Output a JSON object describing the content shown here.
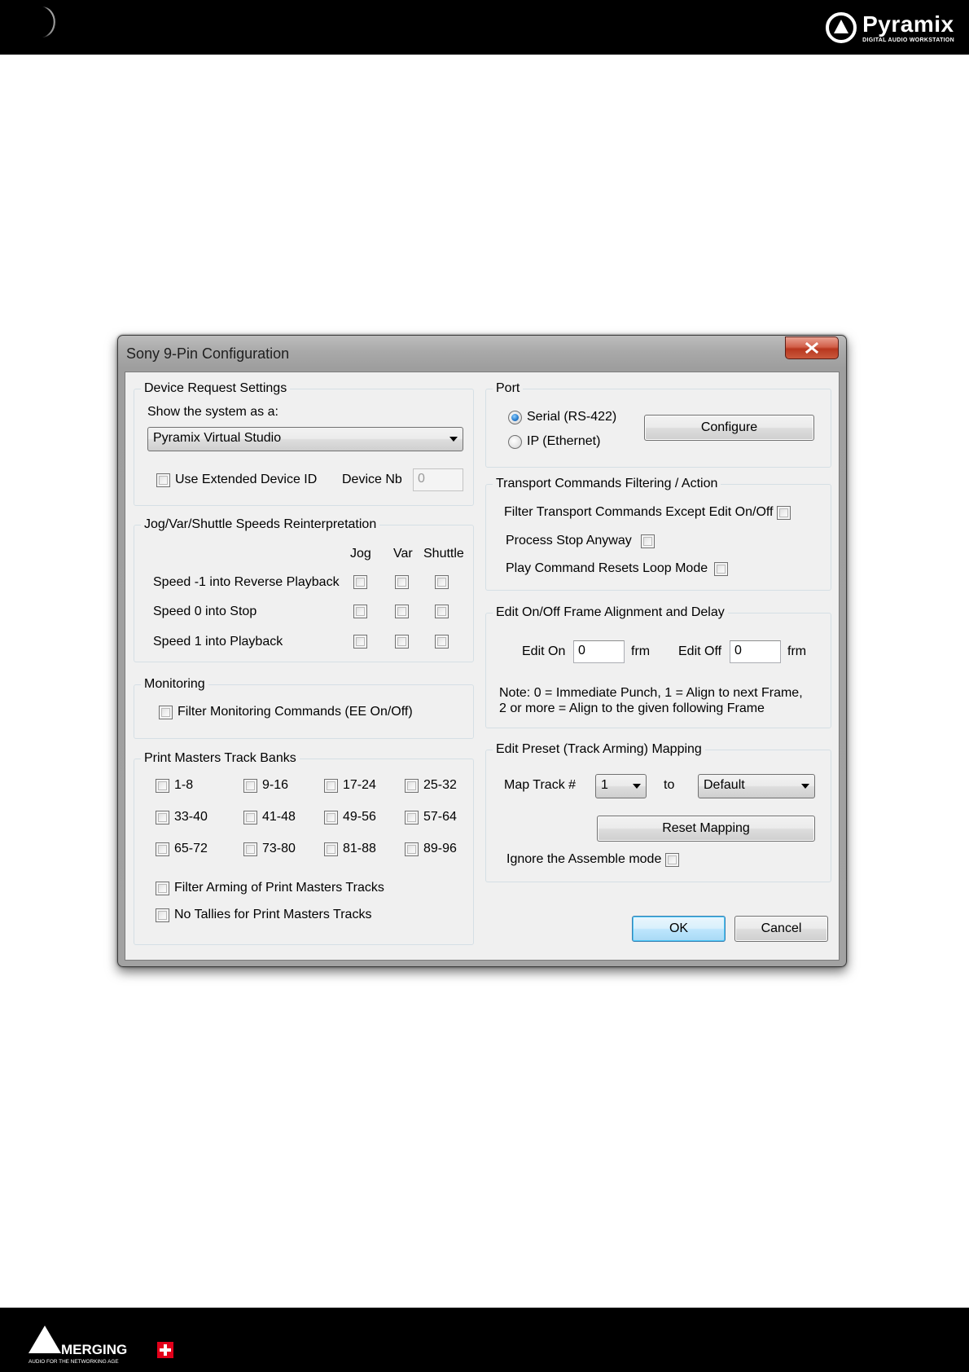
{
  "header": {
    "brand_name": "Pyramix",
    "brand_tagline": "DIGITAL AUDIO WORKSTATION"
  },
  "footer": {
    "brand": "MERGING",
    "tagline": "AUDIO FOR THE NETWORKING AGE"
  },
  "dialog": {
    "title": "Sony 9-Pin Configuration",
    "device_request": {
      "title": "Device Request Settings",
      "show_as_label": "Show the system as a:",
      "show_as_value": "Pyramix Virtual Studio",
      "extended_id_label": "Use Extended Device ID",
      "device_nb_label": "Device Nb",
      "device_nb_value": "0"
    },
    "jog": {
      "title": "Jog/Var/Shuttle Speeds Reinterpretation",
      "columns": [
        "Jog",
        "Var",
        "Shuttle"
      ],
      "rows": [
        "Speed -1 into Reverse Playback",
        "Speed 0 into Stop",
        "Speed 1 into Playback"
      ]
    },
    "monitoring": {
      "title": "Monitoring",
      "filter_label": "Filter Monitoring Commands (EE On/Off)"
    },
    "print_masters": {
      "title": "Print Masters Track Banks",
      "banks": [
        "1-8",
        "9-16",
        "17-24",
        "25-32",
        "33-40",
        "41-48",
        "49-56",
        "57-64",
        "65-72",
        "73-80",
        "81-88",
        "89-96"
      ],
      "filter_arming_label": "Filter Arming of Print Masters Tracks",
      "no_tallies_label": "No Tallies for Print Masters Tracks"
    },
    "port": {
      "title": "Port",
      "serial_label": "Serial (RS-422)",
      "ip_label": "IP (Ethernet)",
      "selected": "Serial (RS-422)",
      "configure_label": "Configure"
    },
    "transport": {
      "title": "Transport Commands Filtering / Action",
      "filter_label": "Filter Transport Commands Except Edit On/Off",
      "stop_label": "Process Stop Anyway",
      "loop_label": "Play Command Resets Loop Mode"
    },
    "edit_align": {
      "title": "Edit On/Off Frame Alignment and Delay",
      "edit_on_label": "Edit On",
      "edit_on_value": "0",
      "edit_off_label": "Edit Off",
      "edit_off_value": "0",
      "unit": "frm",
      "note_line1": "Note: 0 = Immediate Punch, 1 = Align to next Frame,",
      "note_line2": "2 or more = Align to the given following Frame"
    },
    "preset": {
      "title": "Edit Preset (Track Arming) Mapping",
      "map_track_label": "Map Track #",
      "track_value": "1",
      "to_label": "to",
      "target_value": "Default",
      "reset_label": "Reset Mapping",
      "assemble_label": "Ignore the Assemble mode"
    },
    "ok_label": "OK",
    "cancel_label": "Cancel"
  }
}
